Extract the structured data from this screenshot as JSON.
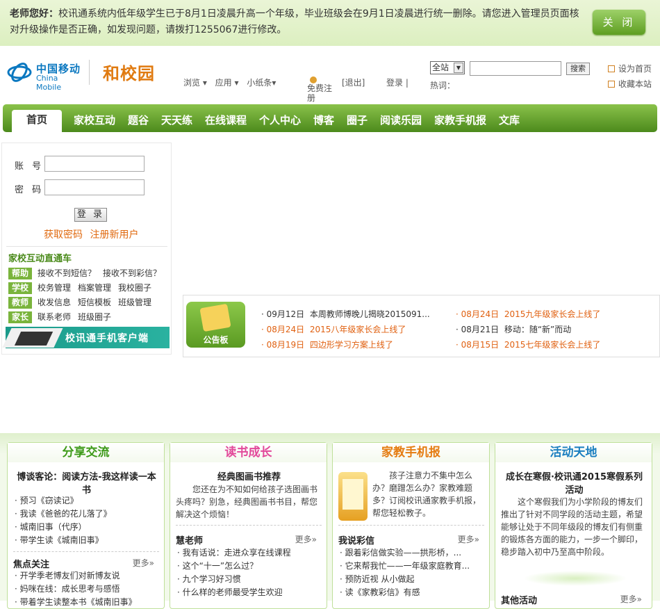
{
  "notice": {
    "lead": "老师您好：",
    "text": "校讯通系统内低年级学生已于8月1日凌晨升高一个年级，毕业班级会在9月1日凌晨进行统一删除。请您进入管理员页面核对升级操作是否正确，如发现问题，请拨打1255067进行修改。",
    "close_label": "关 闭"
  },
  "header": {
    "brand_cn": "中国移动",
    "brand_en": "China Mobile",
    "product": "和校园",
    "mini_nav": [
      "浏览 ▾",
      "应用 ▾",
      "小纸条▾"
    ],
    "register": "免费注册",
    "logout": "[退出]",
    "login": "登录",
    "divider": "|",
    "search_scope": "全站",
    "search_button": "搜索",
    "search_value": "",
    "hot_label": "热词：",
    "set_home": "设为首页",
    "bookmark": "收藏本站"
  },
  "mainnav": {
    "home": "首页",
    "items": [
      "家校互动",
      "题谷",
      "天天练",
      "在线课程",
      "个人中心",
      "博客",
      "圈子",
      "阅读乐园",
      "家教手机报",
      "文库"
    ]
  },
  "login": {
    "account_label": "账 号:",
    "password_label": "密 码:",
    "account_value": "",
    "password_value": "",
    "submit": "登 录",
    "forgot": "获取密码",
    "register": "注册新用户"
  },
  "jiaxiao": {
    "title": "家校互动直通车",
    "rows": [
      {
        "tag": "帮助",
        "links": [
          "接收不到短信？",
          "接收不到彩信？"
        ]
      },
      {
        "tag": "学校",
        "links": [
          "校务管理",
          "档案管理",
          "我校圈子"
        ]
      },
      {
        "tag": "教师",
        "links": [
          "收发信息",
          "短信模板",
          "班级管理"
        ]
      },
      {
        "tag": "家长",
        "links": [
          "联系老师",
          "班级圈子"
        ]
      }
    ],
    "client_banner": "校讯通手机客户端"
  },
  "board": {
    "label": "公告板",
    "news": [
      {
        "date": "09月12日",
        "title": "本周教师博晚儿揭晓2015091...",
        "hot": false
      },
      {
        "date": "08月24日",
        "title": "2015九年级家长会上线了",
        "hot": true
      },
      {
        "date": "08月24日",
        "title": "2015八年级家长会上线了",
        "hot": true
      },
      {
        "date": "08月21日",
        "title": "移动：随“新”而动",
        "hot": false
      },
      {
        "date": "08月19日",
        "title": "四边形学习方案上线了",
        "hot": true
      },
      {
        "date": "08月15日",
        "title": "2015七年级家长会上线了",
        "hot": true
      }
    ]
  },
  "cards": {
    "share": {
      "title": "分享交流",
      "headline": "博谈客论：阅读方法-我这样读一本书",
      "items": [
        "· 预习《窃读记》",
        "· 我读《爸爸的花儿落了》",
        "· 城南旧事（代序）",
        "· 带学生读《城南旧事》"
      ],
      "section": "焦点关注",
      "more": "更多»",
      "items2": [
        "· 开学季老博友们对新博友说",
        "· 妈咪在线：成长思考与感悟",
        "· 带着学生读整本书《城南旧事》"
      ]
    },
    "read": {
      "title": "读书成长",
      "headline": "经典图画书推荐",
      "body": "您还在为不知如何给孩子选图画书头疼吗？别急，经典图画书书目，帮您解决这个烦恼！",
      "section": "慧老师",
      "more": "更多»",
      "items": [
        "· 我有话说：走进众享在线课程",
        "· 这个“十一”怎么过？",
        "· 九个学习好习惯",
        "· 什么样的老师最受学生欢迎"
      ]
    },
    "paper": {
      "title": "家教手机报",
      "body": "孩子注意力不集中怎么办？磨蹭怎么办？家教难题多？订阅校讯通家教手机报，帮您轻松教子。",
      "section": "我说彩信",
      "more": "更多»",
      "items": [
        "· 跟着彩信做实验——拱形桥，...",
        "· 它来帮我忙——一年级家庭教育...",
        "· 预防近视 从小做起",
        "· 读《家教彩信》有感"
      ]
    },
    "activity": {
      "title": "活动天地",
      "headline": "成长在寒假·校讯通2015寒假系列活动",
      "body": "这个寒假我们为小学阶段的博友们推出了针对不同学段的活动主题，希望能够让处于不同年级段的博友们有侧重的锻炼各方面的能力，一步一个脚印，稳步踏入初中乃至高中阶段。",
      "section": "其他活动",
      "more": "更多»"
    }
  }
}
